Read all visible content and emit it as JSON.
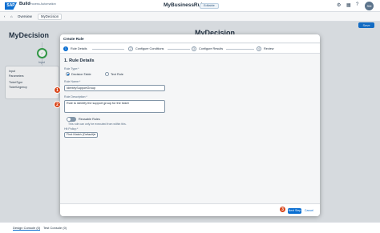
{
  "shell": {
    "logo": "SAP",
    "brand": "Build",
    "brand_sub": "Process Automation",
    "title": "MyBusinessRule",
    "badge": "Editable",
    "avatar": "SM"
  },
  "tabs": {
    "overview": "Overview",
    "mydecision": "MyDecision"
  },
  "page": {
    "title": "MyDecision",
    "title_right": "MyDecision",
    "save": "Save",
    "node_label": "Input",
    "card_lines": [
      "Input",
      "Parameters",
      "TicketType",
      "TicketUrgency"
    ]
  },
  "dialog": {
    "title": "Create Rule",
    "steps": [
      {
        "num": "1",
        "label": "Rule Details",
        "active": true
      },
      {
        "num": "2",
        "label": "Configure Conditions",
        "active": false
      },
      {
        "num": "3",
        "label": "Configure Results",
        "active": false
      },
      {
        "num": "4",
        "label": "Review",
        "active": false
      }
    ],
    "section_title": "1. Rule Details",
    "rule_type_label": "Rule Type:*",
    "radio_decision_table": "Decision Table",
    "radio_text_rule": "Text Rule",
    "rule_name_label": "Rule Name:*",
    "rule_name_value": "IdentifySupportGroup",
    "rule_desc_label": "Rule Description:*",
    "rule_desc_value": "Rule to identify the support group for the ticket",
    "toggle_label": "Reusable Rules",
    "toggle_hint": "This rule can only be executed from within this.",
    "hit_policy_label": "Hit Policy:*",
    "hit_policy_value": "First Match (Default)",
    "next_step": "Next Step",
    "cancel": "Cancel"
  },
  "annotations": [
    "1",
    "2",
    "3"
  ],
  "console": {
    "design": "Design Console (0)",
    "test": "Test Console (0)"
  },
  "colors": {
    "accent": "#0a6ed1",
    "annotation": "#d9461b",
    "success": "#2ea043"
  }
}
